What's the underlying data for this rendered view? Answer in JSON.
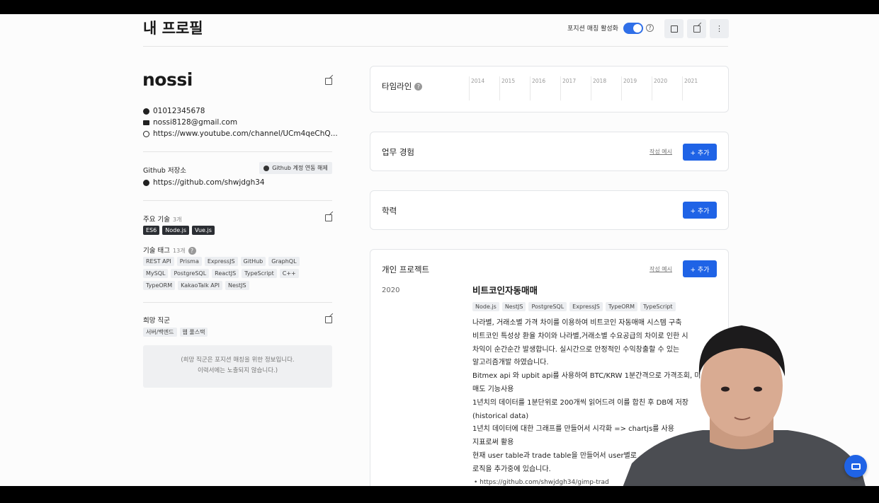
{
  "header": {
    "title": "내 프로필",
    "match_label": "포지션 매칭 활성화",
    "match_enabled": true,
    "help_glyph": "?"
  },
  "profile": {
    "name": "nossi",
    "phone": "01012345678",
    "email": "nossi8128@gmail.com",
    "website": "https://www.youtube.com/channel/UCm4qeChQ..."
  },
  "github": {
    "label": "Github 저장소",
    "unlink_label": "Github 계정 연동 해제",
    "url": "https://github.com/shwjdgh34"
  },
  "skills": {
    "label": "주요 기술",
    "count": "3개",
    "items": [
      "ES6",
      "Node.js",
      "Vue.js"
    ]
  },
  "tags": {
    "label": "기술 태그",
    "count": "13개",
    "help_glyph": "?",
    "items": [
      "REST API",
      "Prisma",
      "ExpressJS",
      "GitHub",
      "GraphQL",
      "MySQL",
      "PostgreSQL",
      "ReactJS",
      "TypeScript",
      "C++",
      "TypeORM",
      "KakaoTalk API",
      "NestJS"
    ]
  },
  "desired_job": {
    "label": "희망 직군",
    "items": [
      "서버/백엔드",
      "웹 풀스택"
    ],
    "notice_line1": "(희망 직군은 포지션 매칭을 위한 정보입니다.",
    "notice_line2": "이력서에는 노출되지 않습니다.)"
  },
  "timeline": {
    "title": "타임라인",
    "help_glyph": "?",
    "years": [
      "2014",
      "2015",
      "2016",
      "2017",
      "2018",
      "2019",
      "2020",
      "2021"
    ]
  },
  "work": {
    "title": "업무 경험",
    "example_label": "작성 예시",
    "add_label": "+ 추가"
  },
  "education": {
    "title": "학력",
    "add_label": "+ 추가"
  },
  "projects": {
    "title": "개인 프로젝트",
    "example_label": "작성 예시",
    "add_label": "+ 추가",
    "item": {
      "year": "2020",
      "name": "비트코인자동매매",
      "tags": [
        "Node.js",
        "NestJS",
        "PostgreSQL",
        "ExpressJS",
        "TypeORM",
        "TypeScript"
      ],
      "desc_lines": [
        "나라별, 거래소별 가격 차이를 이용하여 비트코인 자동매매 시스템 구축",
        "비트코인 특성상 환율 차이와 나라별,거래소별 수요공급의 차이로 인한 시",
        "차익이 순간순간 발생합니다. 실시간으로 안정적인 수익창출할 수 있는",
        "알고리즘개발 하였습니다.",
        "Bitmex api 와 upbit api를 사용하여 BTC/KRW 1분간격으로 가격조회, 미",
        "매도 기능사용",
        "1년치의 데이터를 1분단위로 200개씩 읽어드려 이를 합친 후 DB에 저장",
        "(historical data)",
        "1년치 데이터에 대한 그래프를 만들어서 시각화 => chartjs를 사용",
        "지표로써 활용",
        "현재 user table과 trade table을 만들어서 user별로",
        "로직을 추가중에 있습니다."
      ],
      "link": "https://github.com/shwjdgh34/gimp-trad"
    }
  }
}
